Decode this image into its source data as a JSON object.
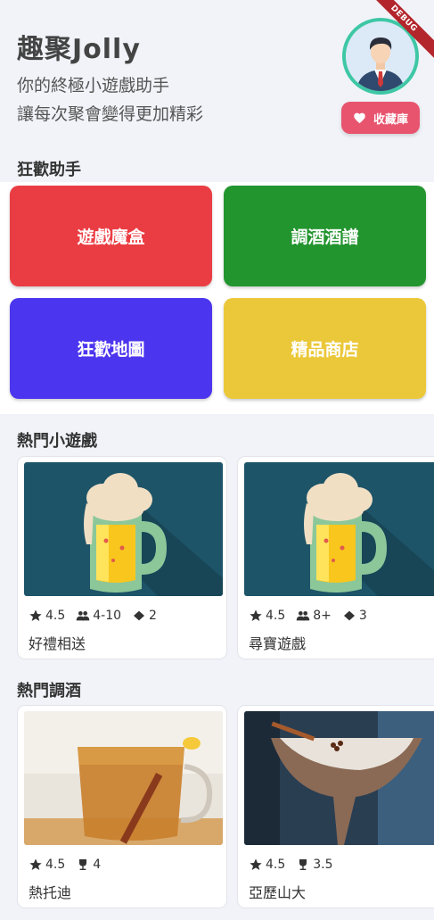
{
  "debug_banner": "DEBUG",
  "header": {
    "app_title": "趣聚Jolly",
    "subtitle_line1": "你的終極小遊戲助手",
    "subtitle_line2": "讓每次聚會變得更加精彩"
  },
  "favorites_button": {
    "label": "收藏庫",
    "icon": "heart-icon"
  },
  "party_helper": {
    "title": "狂歡助手",
    "tiles": [
      {
        "label": "遊戲魔盒",
        "color": "#ea3d43"
      },
      {
        "label": "調酒酒譜",
        "color": "#23952f"
      },
      {
        "label": "狂歡地圖",
        "color": "#4c35ef"
      },
      {
        "label": "精品商店",
        "color": "#ebc83a"
      }
    ]
  },
  "popular_games": {
    "title": "熱門小遊戲",
    "items": [
      {
        "name": "好禮相送",
        "rating": "4.5",
        "players": "4-10",
        "difficulty": "2"
      },
      {
        "name": "尋寶遊戲",
        "rating": "4.5",
        "players": "8+",
        "difficulty": "3"
      }
    ]
  },
  "popular_cocktails": {
    "title": "熱門調酒",
    "items": [
      {
        "name": "熱托迪",
        "rating": "4.5",
        "strength": "4"
      },
      {
        "name": "亞歷山大",
        "rating": "4.5",
        "strength": "3.5"
      }
    ]
  }
}
